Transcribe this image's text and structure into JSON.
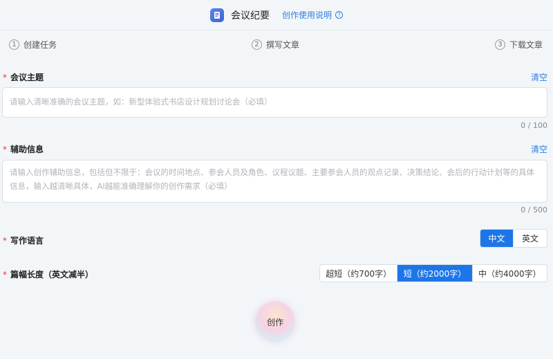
{
  "header": {
    "title": "会议纪要",
    "help_link": "创作使用说明",
    "help_icon": "?"
  },
  "steps": [
    {
      "num": "1",
      "label": "创建任务"
    },
    {
      "num": "2",
      "label": "撰写文章"
    },
    {
      "num": "3",
      "label": "下载文章"
    }
  ],
  "topic": {
    "required_mark": "*",
    "label": "会议主题",
    "clear": "清空",
    "placeholder": "请输入清晰准确的会议主题，如：新型体验式书店设计规划讨论会（必填）",
    "counter": "0 / 100"
  },
  "info": {
    "required_mark": "*",
    "label": "辅助信息",
    "clear": "清空",
    "placeholder": "请输入创作辅助信息，包括但不限于：会议的时间地点、参会人员及角色、议程议题、主要参会人员的观点记录、决策结论、会后的行动计划等的具体信息，输入越清晰具体，AI越能准确理解你的创作需求（必填）",
    "counter": "0 / 500"
  },
  "language": {
    "required_mark": "*",
    "label": "写作语言",
    "options": [
      "中文",
      "英文"
    ],
    "selected": "中文"
  },
  "length": {
    "required_mark": "*",
    "label": "篇幅长度（英文减半）",
    "options": [
      "超短（约700字）",
      "短（约2000字）",
      "中（约4000字）"
    ],
    "selected": "短（约2000字）"
  },
  "create_button": "创作",
  "colors": {
    "accent": "#1d76e8",
    "link": "#2f7de1",
    "required": "#e53935"
  }
}
